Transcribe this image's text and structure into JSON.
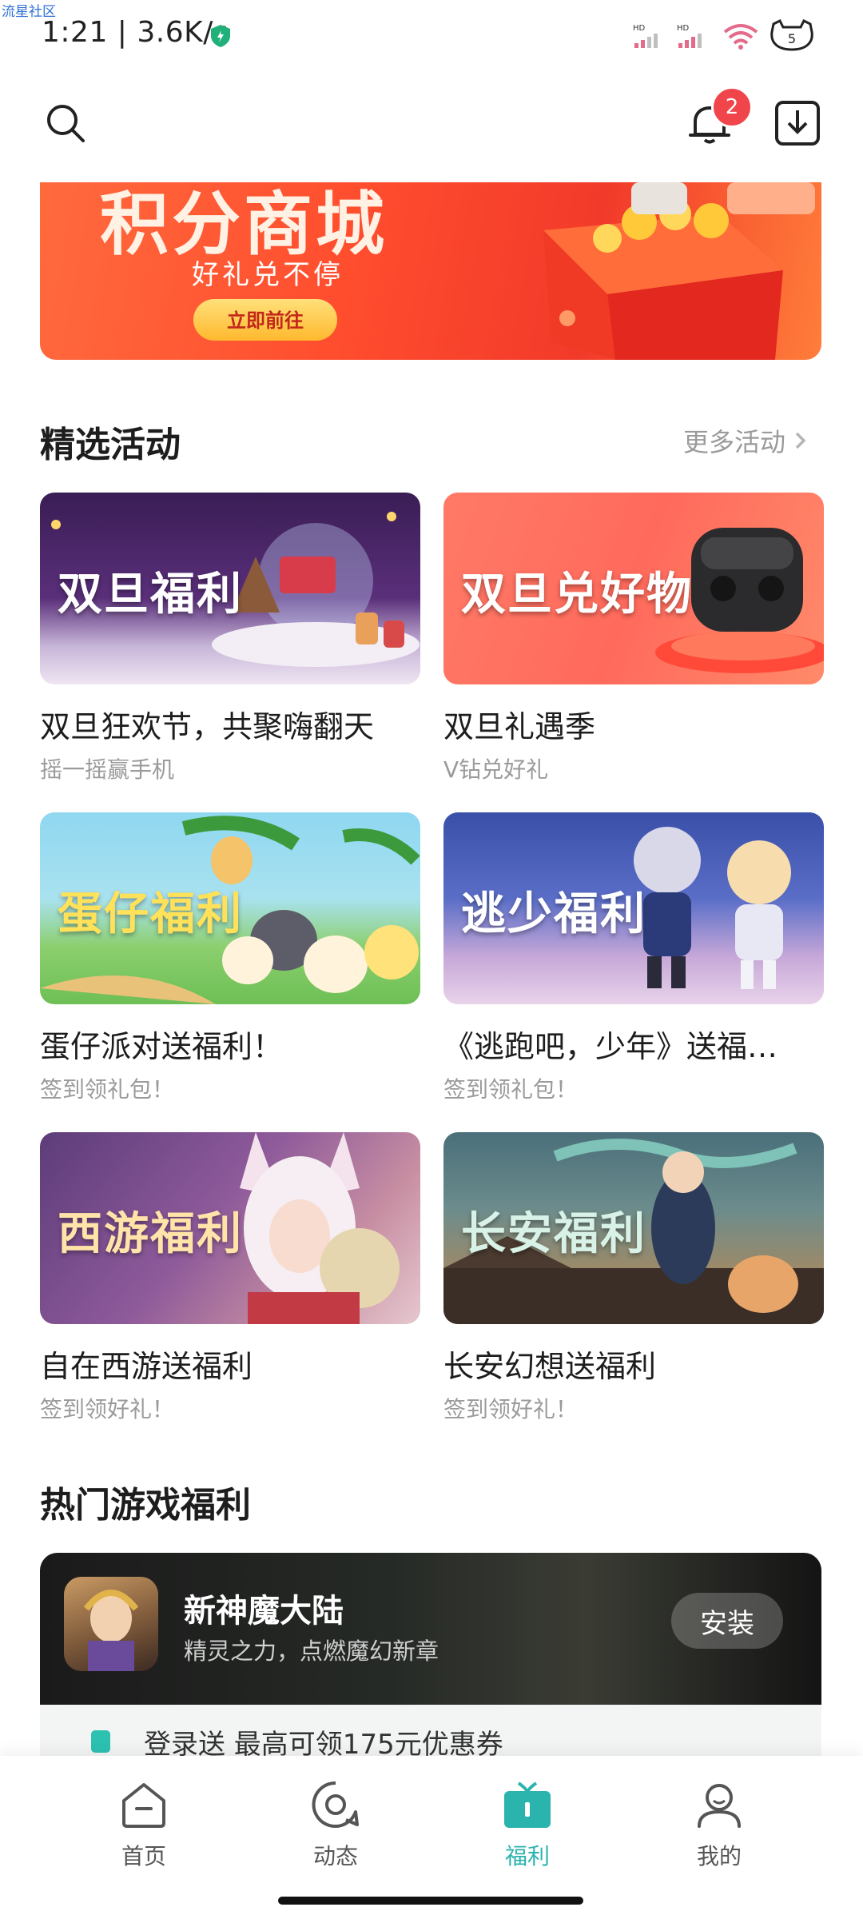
{
  "watermark": "流星社区",
  "status": {
    "time": "1:21 | 3.6K/s",
    "signal_label_1": "HD",
    "signal_label_2": "HD",
    "battery": "5"
  },
  "header": {
    "notification_count": "2"
  },
  "banner": {
    "title_partial": "积分商城",
    "subtitle": "好礼兑不停",
    "button": "立即前往"
  },
  "featured": {
    "title": "精选活动",
    "more": "更多活动",
    "cards": [
      {
        "overlay": "双旦福利",
        "title": "双旦狂欢节，共聚嗨翻天",
        "subtitle": "摇一摇赢手机"
      },
      {
        "overlay": "双旦兑好物",
        "title": "双旦礼遇季",
        "subtitle": "V钻兑好礼"
      },
      {
        "overlay": "蛋仔福利",
        "title": "蛋仔派对送福利！",
        "subtitle": "签到领礼包！"
      },
      {
        "overlay": "逃少福利",
        "title": "《逃跑吧，少年》送福…",
        "subtitle": "签到领礼包！"
      },
      {
        "overlay": "西游福利",
        "title": "自在西游送福利",
        "subtitle": "签到领好礼！"
      },
      {
        "overlay": "长安福利",
        "title": "长安幻想送福利",
        "subtitle": "签到领好礼！"
      }
    ]
  },
  "hot": {
    "title": "热门游戏福利",
    "game": {
      "name": "新神魔大陆",
      "desc": "精灵之力，点燃魔幻新章",
      "button": "安装"
    },
    "gift_row": "登录送 最高可领175元优惠券"
  },
  "tabs": [
    {
      "label": "首页",
      "icon": "home-icon"
    },
    {
      "label": "动态",
      "icon": "feed-icon"
    },
    {
      "label": "福利",
      "icon": "gift-icon",
      "active": true
    },
    {
      "label": "我的",
      "icon": "profile-icon"
    }
  ],
  "colors": {
    "accent": "#2bb3ad",
    "badge": "#f0464b",
    "banner": "#ff4d2e"
  }
}
